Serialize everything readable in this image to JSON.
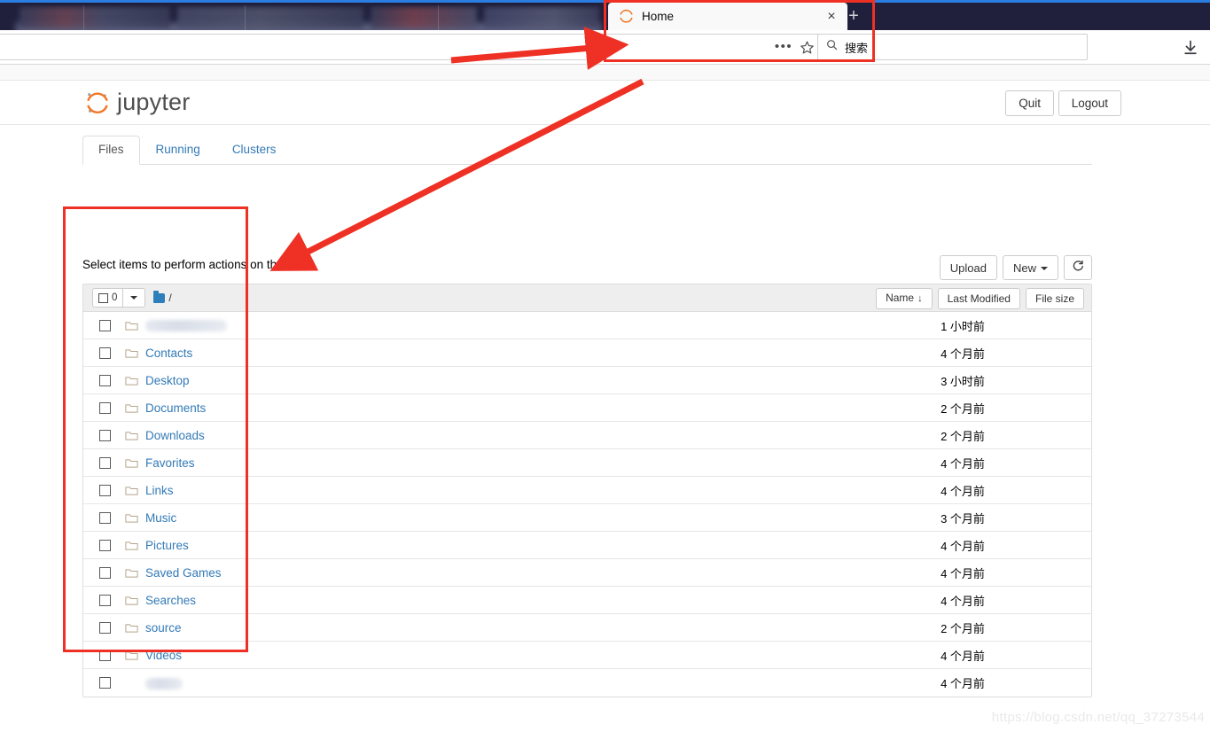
{
  "browser": {
    "active_tab": {
      "title": "Home",
      "favicon": "jupyter-logo-icon",
      "close_label": "×"
    },
    "new_tab_label": "+",
    "url_value": "",
    "more_actions_label": "•••",
    "bookmark_icon": "star-icon",
    "search": {
      "placeholder": "搜索",
      "icon": "search-icon"
    },
    "downloads_icon": "download-arrow-icon",
    "blurred_tab_count": 3
  },
  "jupyter": {
    "brand": "jupyter",
    "quit_label": "Quit",
    "logout_label": "Logout",
    "tabs": [
      {
        "label": "Files",
        "active": true
      },
      {
        "label": "Running",
        "active": false
      },
      {
        "label": "Clusters",
        "active": false
      }
    ],
    "hint": "Select items to perform actions on them.",
    "actions": {
      "upload_label": "Upload",
      "new_label": "New",
      "refresh_icon": "refresh-icon"
    },
    "filelist": {
      "selected_count": "0",
      "breadcrumb_root": "/",
      "breadcrumb_icon": "folder-icon",
      "sort_buttons": [
        {
          "label": "Name",
          "sorted": true,
          "sort_arrow": "↓"
        },
        {
          "label": "Last Modified",
          "sorted": false
        },
        {
          "label": "File size",
          "sorted": false
        }
      ],
      "rows": [
        {
          "name": "",
          "blurred": true,
          "blur_width": 92,
          "icon": "folder-icon",
          "modified": "1 小时前",
          "size": ""
        },
        {
          "name": "Contacts",
          "blurred": false,
          "icon": "folder-icon",
          "modified": "4 个月前",
          "size": ""
        },
        {
          "name": "Desktop",
          "blurred": false,
          "icon": "folder-icon",
          "modified": "3 小时前",
          "size": ""
        },
        {
          "name": "Documents",
          "blurred": false,
          "icon": "folder-icon",
          "modified": "2 个月前",
          "size": ""
        },
        {
          "name": "Downloads",
          "blurred": false,
          "icon": "folder-icon",
          "modified": "2 个月前",
          "size": ""
        },
        {
          "name": "Favorites",
          "blurred": false,
          "icon": "folder-icon",
          "modified": "4 个月前",
          "size": ""
        },
        {
          "name": "Links",
          "blurred": false,
          "icon": "folder-icon",
          "modified": "4 个月前",
          "size": ""
        },
        {
          "name": "Music",
          "blurred": false,
          "icon": "folder-icon",
          "modified": "3 个月前",
          "size": ""
        },
        {
          "name": "Pictures",
          "blurred": false,
          "icon": "folder-icon",
          "modified": "4 个月前",
          "size": ""
        },
        {
          "name": "Saved Games",
          "blurred": false,
          "icon": "folder-icon",
          "modified": "4 个月前",
          "size": ""
        },
        {
          "name": "Searches",
          "blurred": false,
          "icon": "folder-icon",
          "modified": "4 个月前",
          "size": ""
        },
        {
          "name": "source",
          "blurred": false,
          "icon": "folder-icon",
          "modified": "2 个月前",
          "size": ""
        },
        {
          "name": "Videos",
          "blurred": false,
          "icon": "folder-icon",
          "modified": "4 个月前",
          "size": ""
        },
        {
          "name": "",
          "blurred": true,
          "blur_width": 42,
          "icon": "none",
          "modified": "4 个月前",
          "size": ""
        }
      ]
    }
  },
  "annotations": {
    "color": "#ee3124",
    "rect_tab_label": "browser-tab-highlight",
    "rect_filelist_label": "file-list-highlight"
  },
  "watermark": "https://blog.csdn.net/qq_37273544"
}
